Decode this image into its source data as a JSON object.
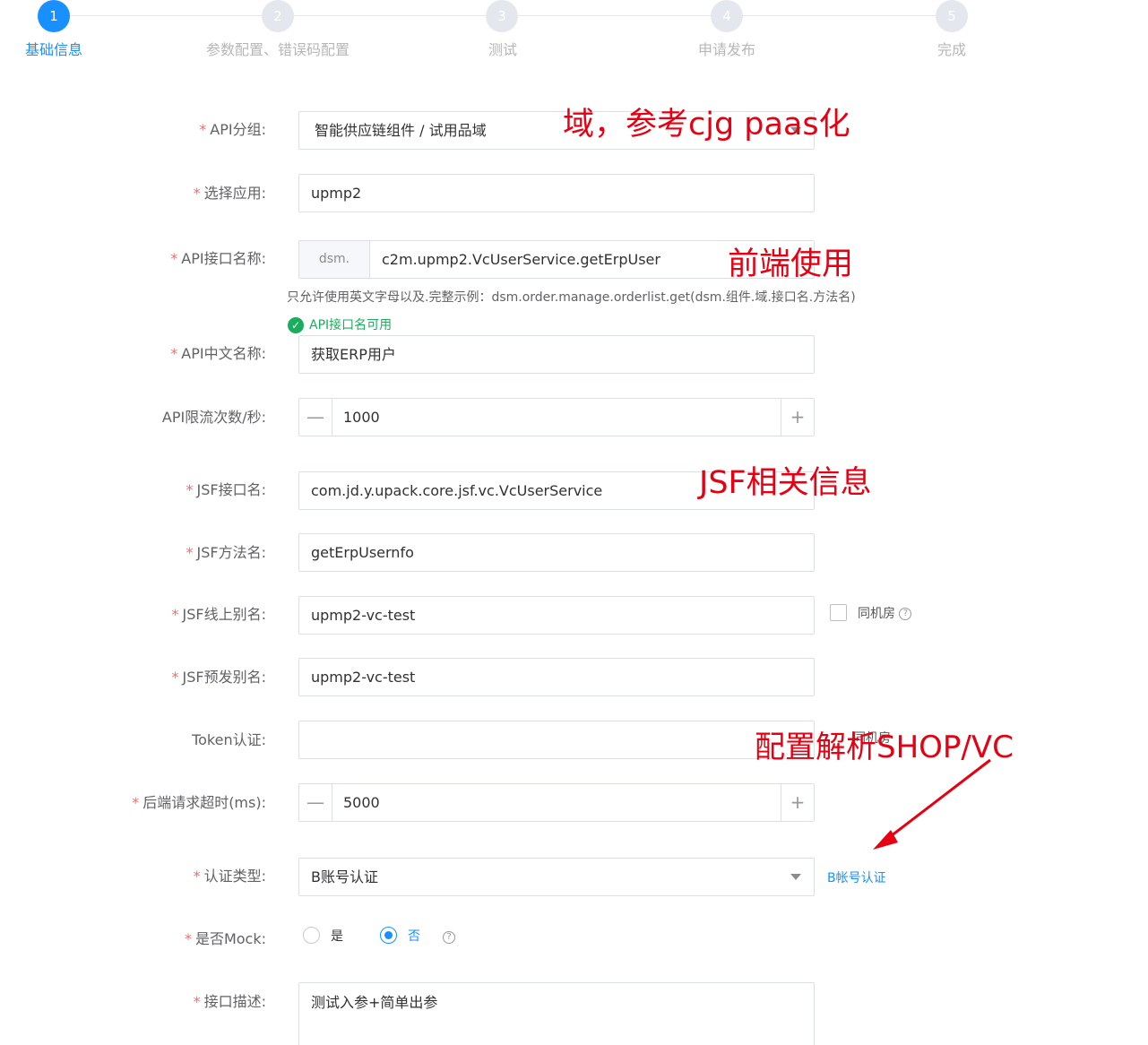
{
  "steps": [
    {
      "num": "1",
      "label": "基础信息",
      "active": true
    },
    {
      "num": "2",
      "label": "参数配置、错误码配置",
      "active": false
    },
    {
      "num": "3",
      "label": "测试",
      "active": false
    },
    {
      "num": "4",
      "label": "申请发布",
      "active": false
    },
    {
      "num": "5",
      "label": "完成",
      "active": false
    }
  ],
  "form": {
    "api_group": {
      "label": "API分组:",
      "value": "智能供应链组件 / 试用品域"
    },
    "app": {
      "label": "选择应用:",
      "value": "upmp2"
    },
    "api_name": {
      "label": "API接口名称:",
      "prefix": "dsm.",
      "value": "c2m.upmp2.VcUserService.getErpUser",
      "hint": "只允许使用英文字母以及.完整示例：dsm.order.manage.orderlist.get(dsm.组件.域.接口名.方法名)",
      "ok": "API接口名可用"
    },
    "api_cn_name": {
      "label": "API中文名称:",
      "value": "获取ERP用户"
    },
    "rate_limit": {
      "label": "API限流次数/秒:",
      "value": "1000"
    },
    "jsf_interface": {
      "label": "JSF接口名:",
      "value": "com.jd.y.upack.core.jsf.vc.VcUserService"
    },
    "jsf_method": {
      "label": "JSF方法名:",
      "value": "getErpUsernfo"
    },
    "jsf_online_alias": {
      "label": "JSF线上别名:",
      "value": "upmp2-vc-test",
      "checkbox_label": "同机房"
    },
    "jsf_pre_alias": {
      "label": "JSF预发别名:",
      "value": "upmp2-vc-test"
    },
    "token": {
      "label": "Token认证:",
      "value": "",
      "overlap_text": "同机房"
    },
    "timeout": {
      "label": "后端请求超时(ms):",
      "value": "5000"
    },
    "auth_type": {
      "label": "认证类型:",
      "value": "B账号认证",
      "link": "B帐号认证"
    },
    "mock": {
      "label": "是否Mock:",
      "yes": "是",
      "no": "否",
      "selected": "否"
    },
    "description": {
      "label": "接口描述:",
      "value": "测试入参+简单出参"
    }
  },
  "annotations": {
    "domain": "域，参考cjg paas化",
    "frontend": "前端使用",
    "jsf": "JSF相关信息",
    "config": "配置解析SHOP/VC"
  },
  "colors": {
    "accent": "#1890ff",
    "required": "#f56c6c",
    "annotation": "#e60012",
    "success": "#1aad5c"
  }
}
